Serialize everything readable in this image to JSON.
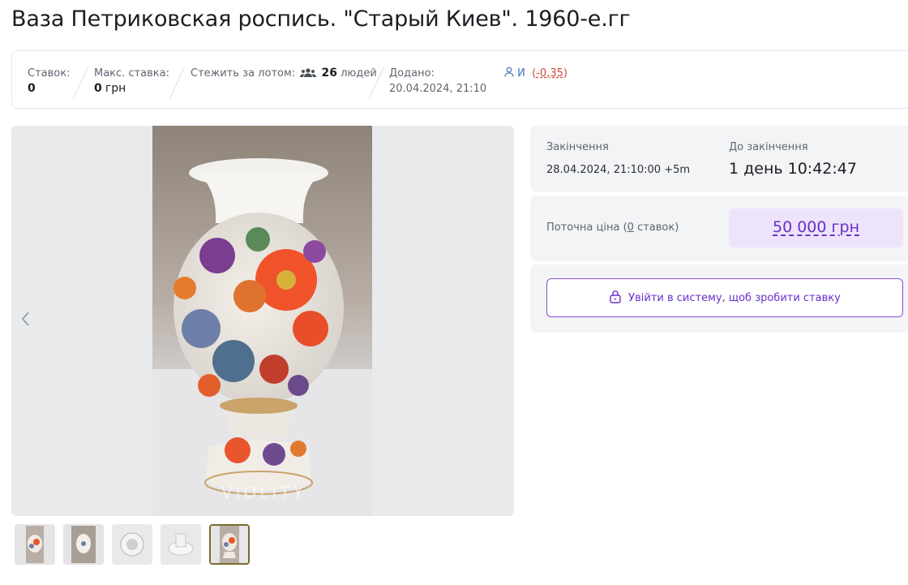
{
  "title": "Ваза Петриковская роспись. \"Старый Киев\". 1960-е.гг",
  "stats": {
    "bids_label": "Ставок:",
    "bids_value": "0",
    "max_bid_label": "Макс. ставка:",
    "max_bid_value": "0",
    "max_bid_currency": "грн",
    "watch_label": "Стежить за лотом:",
    "watch_count": "26",
    "watch_unit": "людей",
    "added_label": "Додано:",
    "added_value": "20.04.2024, 21:10",
    "seller_name": "И",
    "seller_rating_open": "(",
    "seller_rating": "-0,35",
    "seller_rating_close": ")"
  },
  "gallery": {
    "watermark": "VIOLITY",
    "prev_icon": "chevron-left-icon",
    "thumbnails_count": 5,
    "active_thumbnail": 5
  },
  "auction": {
    "end_label": "Закінчення",
    "end_value": "28.04.2024, 21:10:00 +5m",
    "remaining_label": "До закінчення",
    "remaining_value": "1 день 10:42:47",
    "current_price_label_pre": "Поточна ціна (",
    "current_price_bids": "0",
    "current_price_label_post": " ставок)",
    "current_price": "50 000 грн",
    "login_button": "Увійти в систему, щоб зробити ставку",
    "login_icon": "lock-icon"
  },
  "colors": {
    "accent": "#6a2fc8",
    "price_bg": "#ede4fb",
    "panel_bg": "#f3f4f5",
    "rating": "#d1453b",
    "link": "#3b74b8"
  }
}
